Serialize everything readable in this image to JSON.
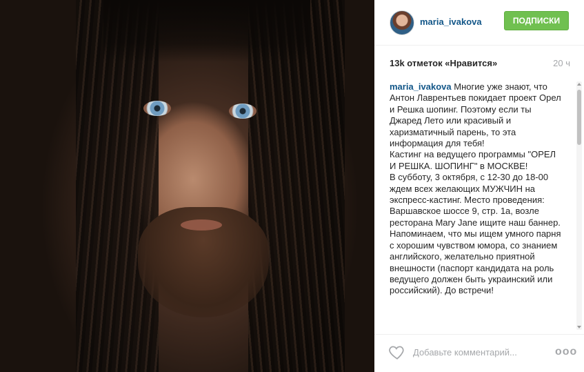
{
  "post": {
    "username": "maria_ivakova",
    "follow_label": "ПОДПИСКИ",
    "likes": "13k отметок «Нравится»",
    "time": "20 ч"
  },
  "caption": {
    "user": "maria_ivakova",
    "paragraphs": [
      " Многие уже знают, что Антон Лаврентьев покидает проект Орел и Решка шопинг. Поэтому если ты Джаред Лето или красивый и харизматичный парень, то эта информация для тебя!",
      "Кастинг на ведущего программы \"ОРЕЛ И РЕШКА. ШОПИНГ\" в МОСКВЕ!",
      "В субботу, 3 октября, с 12-30 до 18-00 ждем всех желающих МУЖЧИН на экспресс-кастинг. Место проведения: Варшавское шоссе 9, стр. 1а, возле ресторана Mary Jane ищите наш баннер.",
      "Напоминаем, что мы ищем умного парня с хорошим чувством юмора, со знанием английского, желательно приятной внешности (паспорт кандидата на роль ведущего должен быть украинский или российский). До встречи!"
    ]
  },
  "footer": {
    "comment_placeholder": "Добавьте комментарий...",
    "like_icon": "heart-outline-icon",
    "more_icon": "more-horizontal-icon",
    "more_glyph": "ooo"
  },
  "colors": {
    "username": "#125688",
    "follow_button": "#70c050",
    "muted": "#a5a7aa"
  }
}
